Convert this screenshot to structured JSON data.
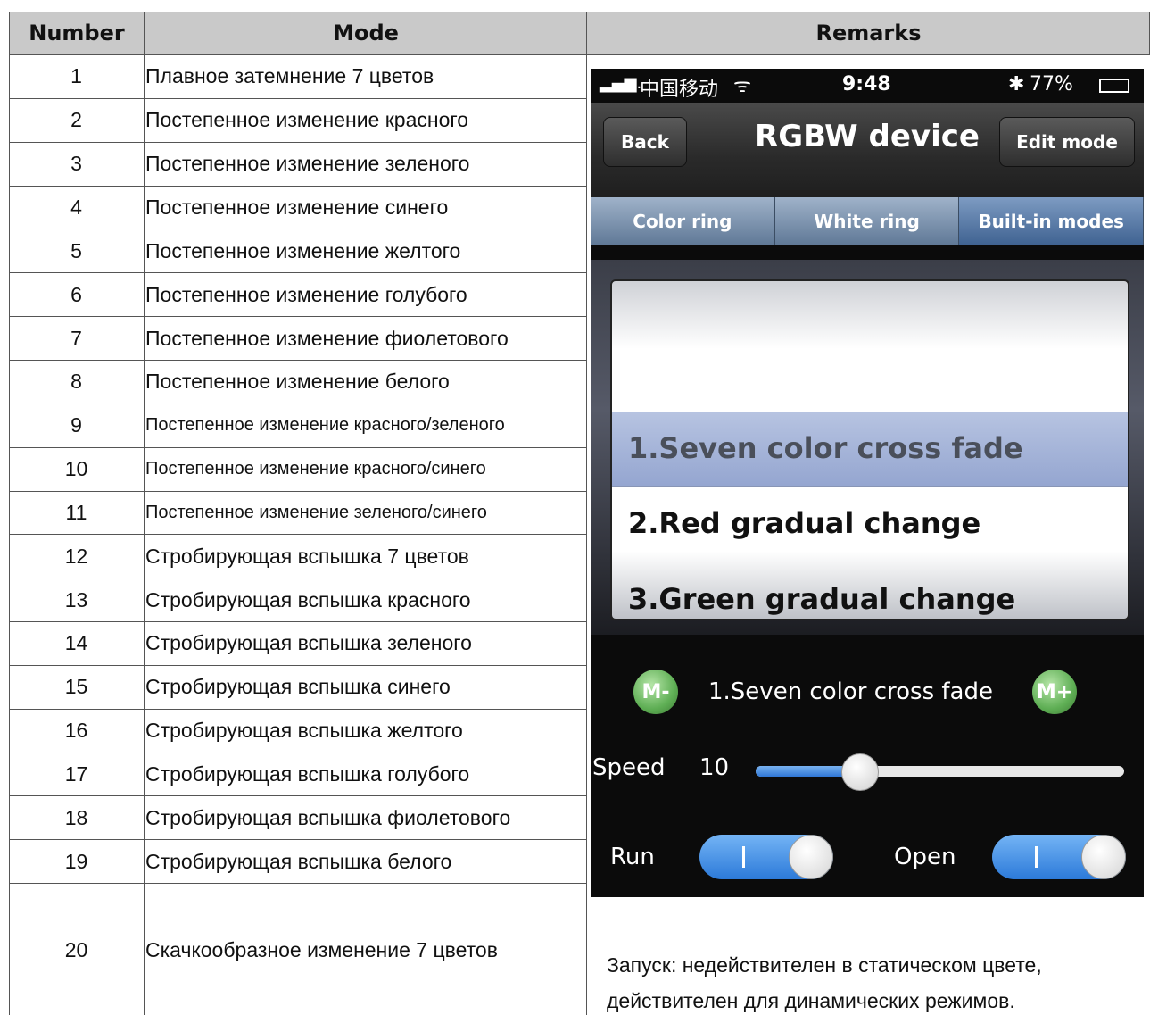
{
  "header": {
    "number": "Number",
    "mode": "Mode",
    "remarks": "Remarks"
  },
  "rows": [
    {
      "n": "1",
      "mode": "Плавное затемнение 7 цветов"
    },
    {
      "n": "2",
      "mode": "Постепенное изменение красного"
    },
    {
      "n": "3",
      "mode": "Постепенное изменение зеленого"
    },
    {
      "n": "4",
      "mode": "Постепенное изменение синего"
    },
    {
      "n": "5",
      "mode": "Постепенное изменение желтого"
    },
    {
      "n": "6",
      "mode": "Постепенное изменение голубого"
    },
    {
      "n": "7",
      "mode": "Постепенное изменение фиолетового"
    },
    {
      "n": "8",
      "mode": "Постепенное изменение белого"
    },
    {
      "n": "9",
      "mode": "Постепенное изменение красного/зеленого"
    },
    {
      "n": "10",
      "mode": "Постепенное изменение красного/синего"
    },
    {
      "n": "11",
      "mode": "Постепенное изменение зеленого/синего"
    },
    {
      "n": "12",
      "mode": "Стробирующая вспышка 7 цветов"
    },
    {
      "n": "13",
      "mode": "Стробирующая вспышка красного"
    },
    {
      "n": "14",
      "mode": "Стробирующая вспышка зеленого"
    },
    {
      "n": "15",
      "mode": "Стробирующая вспышка синего"
    },
    {
      "n": "16",
      "mode": "Стробирующая вспышка желтого"
    },
    {
      "n": "17",
      "mode": "Стробирующая вспышка голубого"
    },
    {
      "n": "18",
      "mode": "Стробирующая вспышка фиолетового"
    },
    {
      "n": "19",
      "mode": "Стробирующая вспышка белого"
    },
    {
      "n": "20",
      "mode": "Скачкообразное изменение 7 цветов"
    }
  ],
  "phone": {
    "status": {
      "carrier": "中国移动",
      "time": "9:48",
      "battery": "77%"
    },
    "nav": {
      "back": "Back",
      "title": "RGBW device",
      "edit": "Edit mode"
    },
    "tabs": [
      "Color ring",
      "White ring",
      "Built-in modes"
    ],
    "picker": [
      "1.Seven color cross fade",
      "2.Red  gradual change",
      "3.Green gradual change"
    ],
    "current_mode": "1.Seven color cross fade",
    "m_minus": "M-",
    "m_plus": "M+",
    "speed_label": "Speed",
    "speed_value": "10",
    "speed_fraction": 0.28,
    "run_label": "Run",
    "open_label": "Open",
    "run_on": true,
    "open_on": true,
    "accent": "#2c7ad9"
  },
  "remarks_text": [
    "Запуск: недействителен в статическом цвете,",
    "действителен для динамических режимов."
  ]
}
